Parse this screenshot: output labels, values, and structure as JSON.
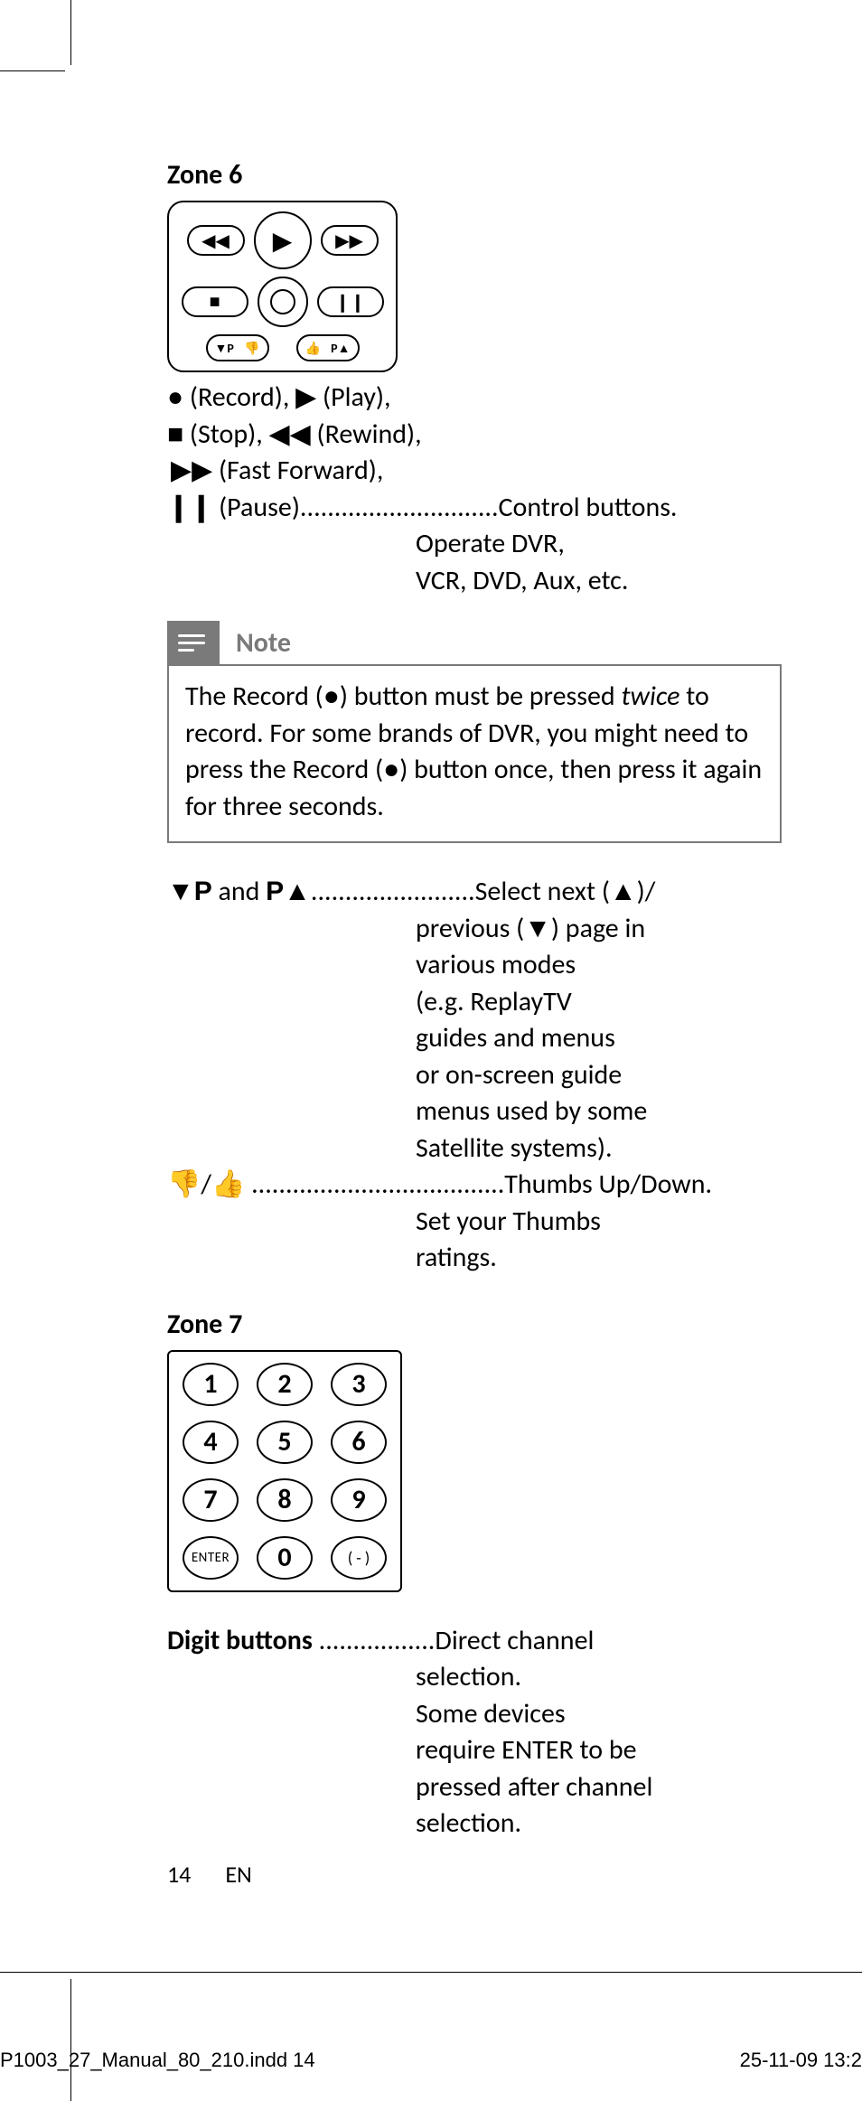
{
  "zone6": {
    "heading": "Zone 6",
    "buttonsLineParts": {
      "record": "(Record),",
      "play": "(Play),",
      "stop": "(Stop),",
      "rewind": "(Rewind),",
      "ff": "(Fast Forward),",
      "pauseLabel": "(Pause)",
      "pauseDots": ".............................",
      "desc1": "Control buttons.",
      "desc2": "Operate DVR,",
      "desc3": "VCR, DVD, Aux, etc."
    },
    "note": {
      "label": "Note",
      "text1": "The Record (",
      "text2": ") button must be pressed ",
      "textItalic": "twice",
      "text3": " to record. For some brands of DVR, you might need to press the Record (",
      "text4": ") button once, then press it again for three seconds."
    },
    "p": {
      "leftPrefix": "▼P",
      "and": "  and ",
      "rightPrefix": "P▲",
      "dots": "........................",
      "r1": "Select next (▲)/",
      "r2": "previous (▼) page in",
      "r3": "various modes",
      "r4": "(e.g. ReplayTV",
      "r5": "guides and menus",
      "r6": "or on-screen guide",
      "r7": "menus used by some",
      "r8": "Satellite systems)."
    },
    "thumbs": {
      "left": "👎/👍",
      "dots": " .....................................",
      "r1": "Thumbs Up/Down.",
      "r2": "Set your Thumbs",
      "r3": "ratings."
    }
  },
  "zone7": {
    "heading": "Zone 7",
    "keys": [
      "1",
      "2",
      "3",
      "4",
      "5",
      "6",
      "7",
      "8",
      "9",
      "ENTER",
      "0",
      "( - )"
    ],
    "digit": {
      "label": "Digit buttons ",
      "dots": ".................",
      "r1": "Direct channel",
      "r2": "selection.",
      "r3": "Some devices",
      "r4": "require ENTER to be",
      "r5": "pressed after channel",
      "r6": "selection."
    }
  },
  "footer": {
    "page": "14",
    "lang": "EN"
  },
  "indd": {
    "left": "P1003_27_Manual_80_210.indd   14",
    "right": "25-11-09   13:2"
  },
  "glyphs": {
    "recDot": "●",
    "play": "▶",
    "stop": "■",
    "rewind": "◀◀",
    "ff": "▶▶",
    "pause": "❙❙",
    "pauseSmall": "❙❙",
    "tdown": "▼",
    "tup": "▲"
  }
}
